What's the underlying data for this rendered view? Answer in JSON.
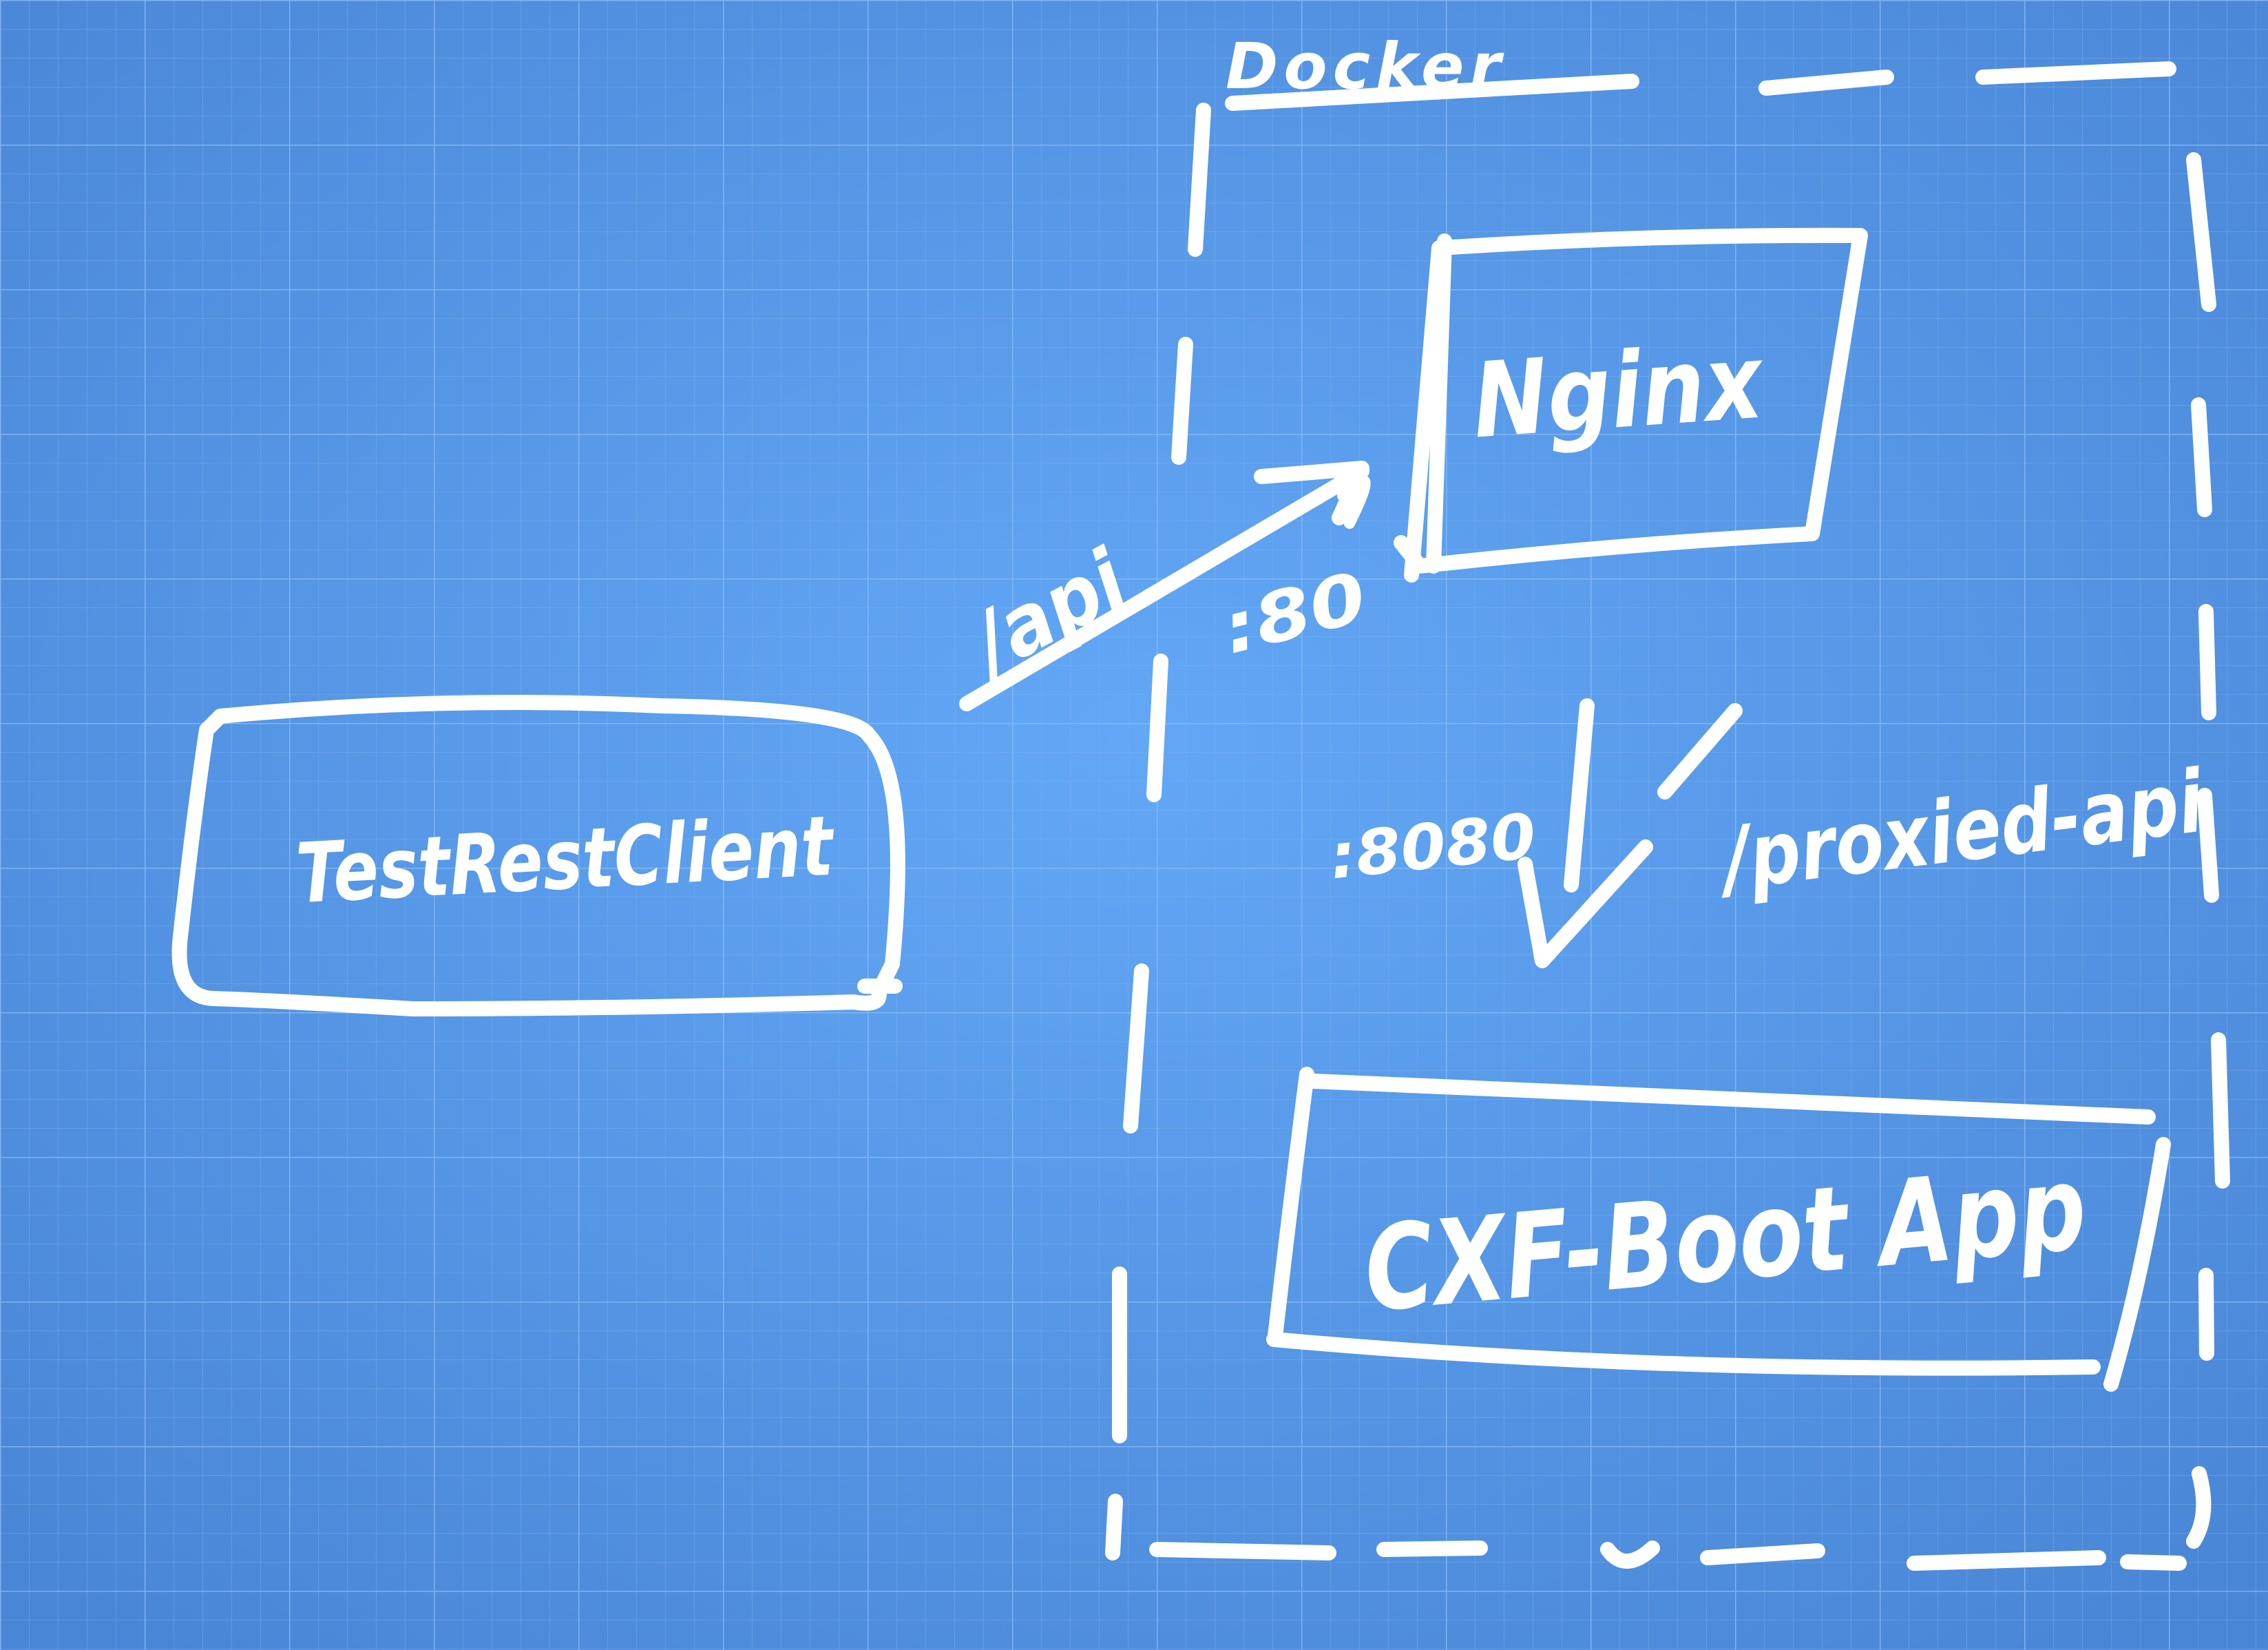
{
  "diagram": {
    "container_label": "Docker",
    "nodes": {
      "client": "TestRestClient",
      "proxy": "Nginx",
      "app": "CXF-Boot App"
    },
    "edges": {
      "client_to_proxy": {
        "path": "/api",
        "port": ":80"
      },
      "proxy_to_app": {
        "path": "/proxied-api",
        "port": ":8080"
      }
    }
  },
  "colors": {
    "background": "#4f8fdc",
    "background_center": "#62a8f6",
    "grid_major": "#8cc0f7",
    "grid_minor": "#79b2f0",
    "ink": "#ffffff"
  }
}
